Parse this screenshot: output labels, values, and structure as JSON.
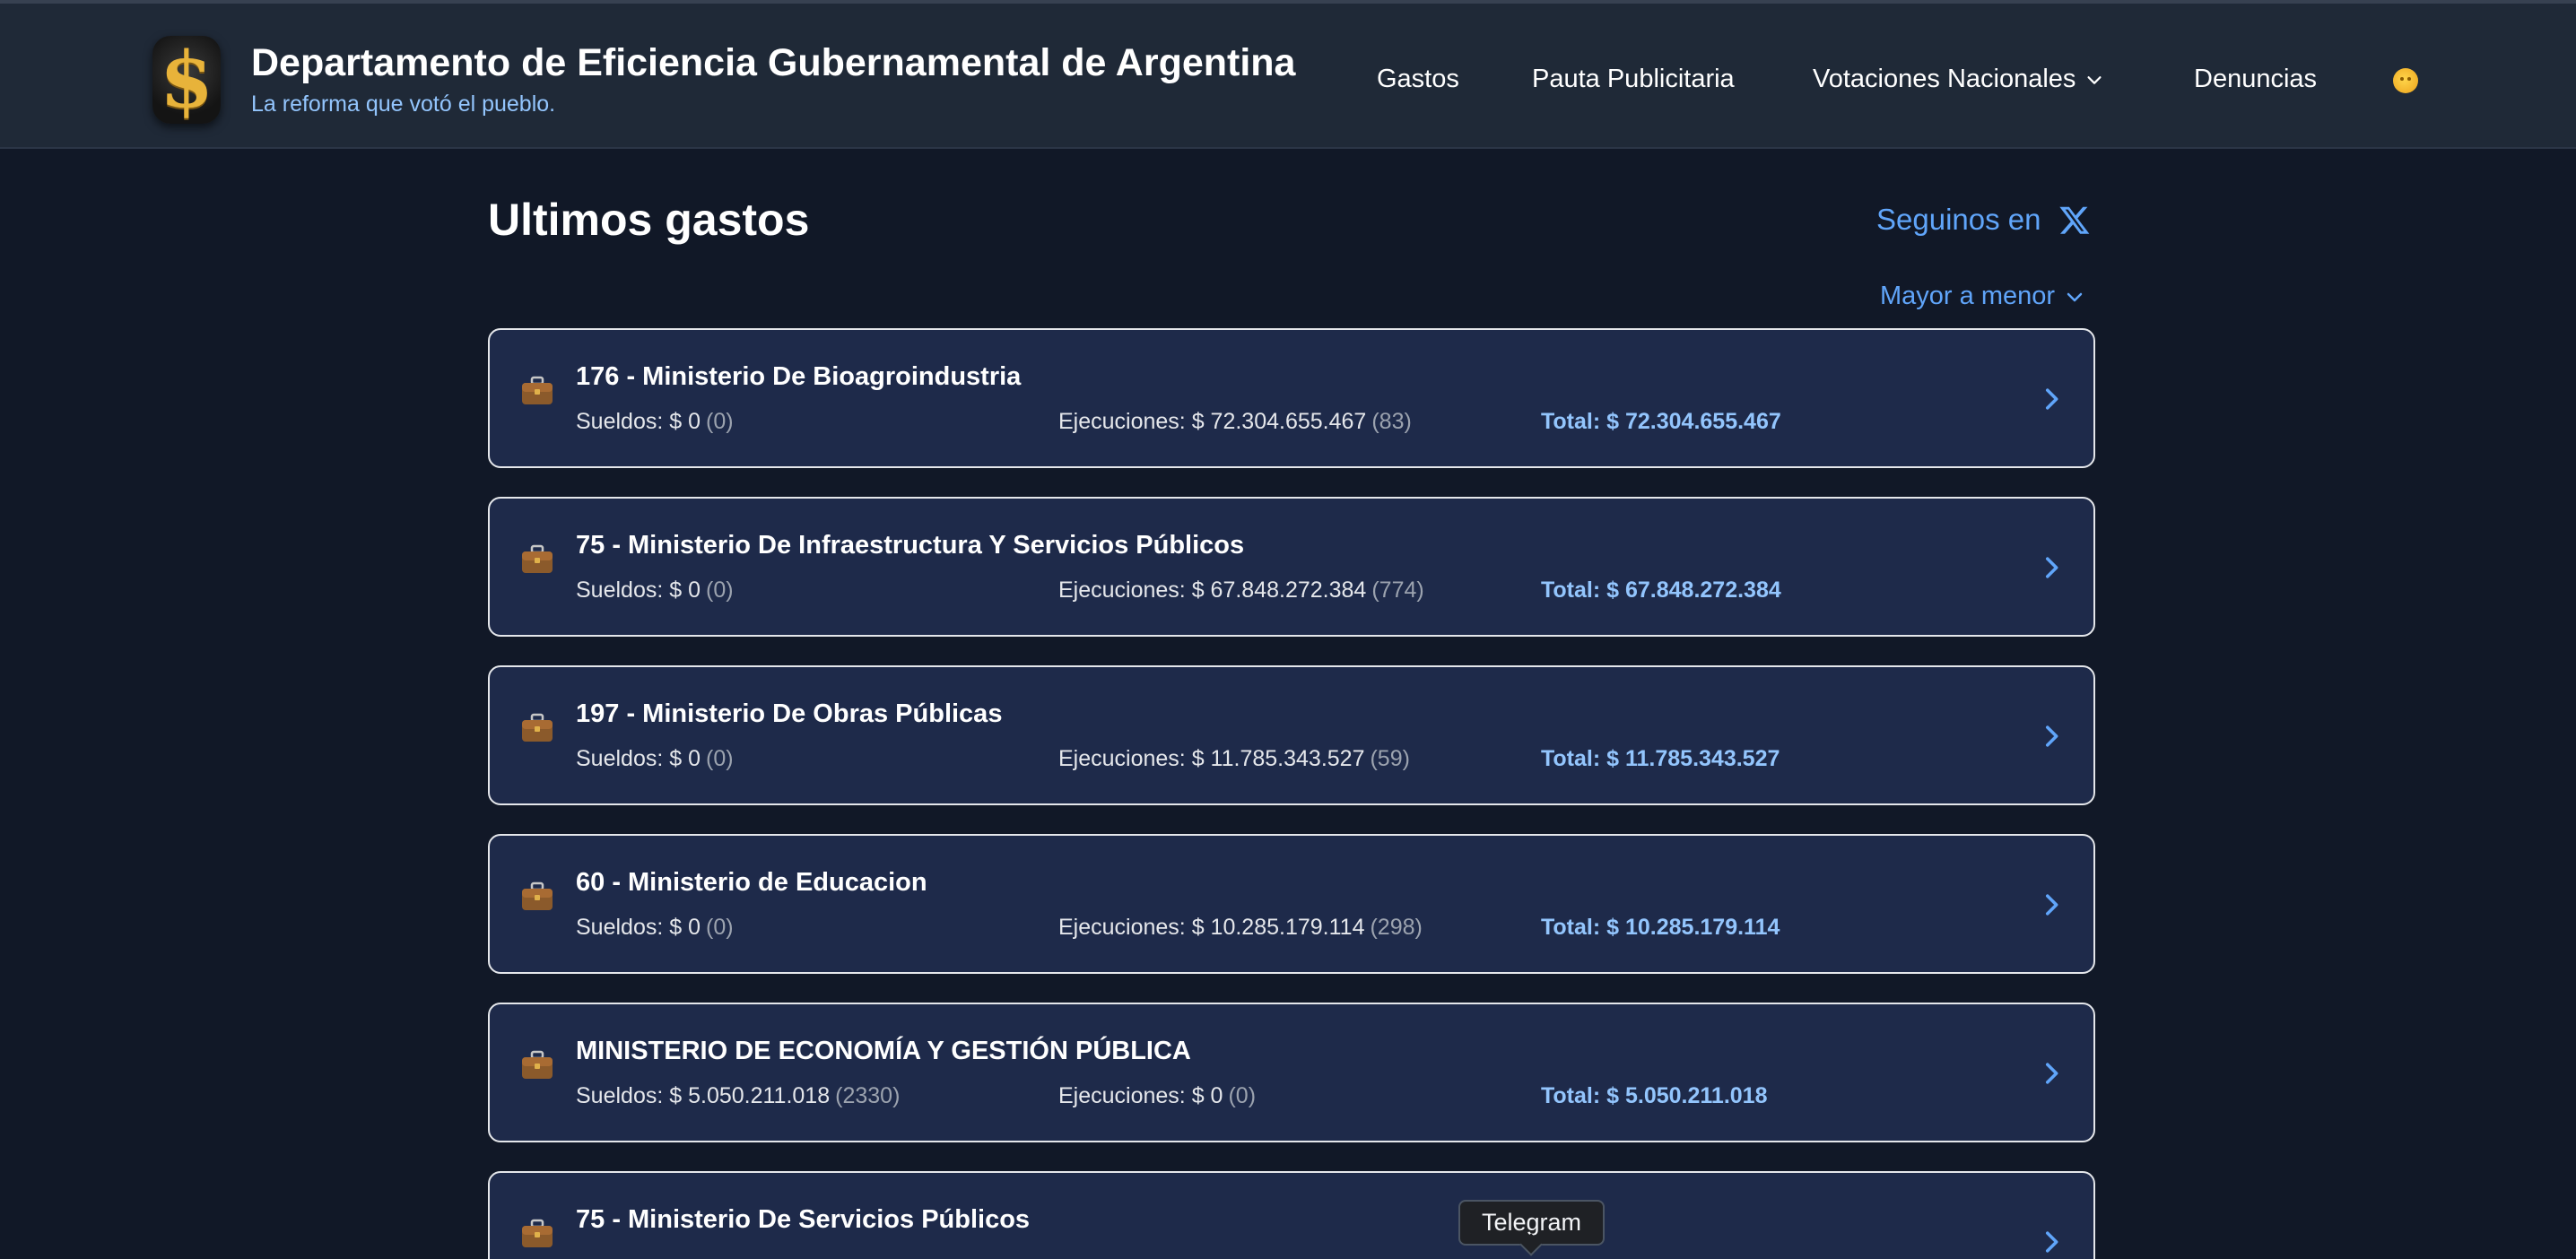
{
  "header": {
    "title": "Departamento de Eficiencia Gubernamental de Argentina",
    "subtitle": "La reforma que votó el pueblo.",
    "nav": {
      "gastos": "Gastos",
      "pauta": "Pauta Publicitaria",
      "votaciones": "Votaciones Nacionales",
      "denuncias": "Denuncias"
    }
  },
  "main": {
    "title": "Ultimos gastos",
    "follow_label": "Seguinos en",
    "sort_label": "Mayor a menor"
  },
  "labels": {
    "sueldos": "Sueldos:",
    "ejecuciones": "Ejecuciones:",
    "total": "Total:"
  },
  "cards": [
    {
      "title": "176 - Ministerio De Bioagroindustria",
      "sueldos": "$ 0",
      "sueldos_count": "(0)",
      "ejecuciones": "$ 72.304.655.467",
      "ejecuciones_count": "(83)",
      "total": "$ 72.304.655.467"
    },
    {
      "title": "75 - Ministerio De Infraestructura Y Servicios Públicos",
      "sueldos": "$ 0",
      "sueldos_count": "(0)",
      "ejecuciones": "$ 67.848.272.384",
      "ejecuciones_count": "(774)",
      "total": "$ 67.848.272.384"
    },
    {
      "title": "197 - Ministerio De Obras Públicas",
      "sueldos": "$ 0",
      "sueldos_count": "(0)",
      "ejecuciones": "$ 11.785.343.527",
      "ejecuciones_count": "(59)",
      "total": "$ 11.785.343.527"
    },
    {
      "title": "60 - Ministerio de Educacion",
      "sueldos": "$ 0",
      "sueldos_count": "(0)",
      "ejecuciones": "$ 10.285.179.114",
      "ejecuciones_count": "(298)",
      "total": "$ 10.285.179.114"
    },
    {
      "title": "MINISTERIO DE ECONOMÍA Y GESTIÓN PÚBLICA",
      "sueldos": "$ 5.050.211.018",
      "sueldos_count": "(2330)",
      "ejecuciones": "$ 0",
      "ejecuciones_count": "(0)",
      "total": "$ 5.050.211.018"
    },
    {
      "title": "75 - Ministerio De Servicios Públicos"
    }
  ],
  "tooltip": "Telegram",
  "colors": {
    "background": "#111827",
    "header": "#1f2937",
    "card": "#1e2a4a",
    "accent": "#60a5fa",
    "total": "#93c5fd"
  },
  "icons": {
    "logo": "dollar-logo-icon",
    "theme": "sun-icon",
    "card": "briefcase-icon",
    "row": "chevron-right-icon",
    "social": "x-logo-icon"
  }
}
